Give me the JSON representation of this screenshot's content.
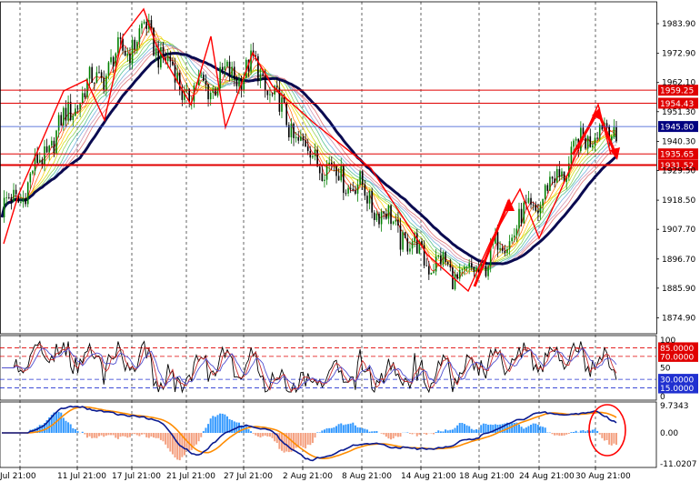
{
  "colors": {
    "background": "#ffffff",
    "border": "#000000",
    "grid": "#000000",
    "bull_candle": "#008000",
    "bear_candle": "#000000",
    "level_line": "#e00000",
    "level_tag": "#e00000",
    "current_line": "#3050d0",
    "current_tag": "#000080",
    "ma_slow": "#0a0a50",
    "annotation": "#ff0000",
    "rsi_main": "#000000",
    "rsi_signal": "#cc3030",
    "rsi_signal2": "#5050d0",
    "osc_level_high": "#e00000",
    "osc_level_low": "#2030d0",
    "osc_tag_high": "#e00000",
    "osc_tag_low": "#2030d0",
    "macd_pos": "#3399ff",
    "macd_neg": "#f4a080",
    "macd_line": "#0a1a90",
    "macd_signal": "#ff8c00"
  },
  "chart_data": [
    {
      "type": "candlestick",
      "title": "",
      "x_tick_labels": [
        "Jul 21:00",
        "11 Jul 21:00",
        "17 Jul 21:00",
        "21 Jul 21:00",
        "27 Jul 21:00",
        "2 Aug 21:00",
        "8 Aug 21:00",
        "14 Aug 21:00",
        "18 Aug 21:00",
        "24 Aug 21:00",
        "30 Aug 21:00"
      ],
      "y_tick_labels": [
        "1983.90",
        "1972.90",
        "1962.10",
        "1951.30",
        "1940.30",
        "1929.50",
        "1918.50",
        "1907.70",
        "1896.70",
        "1885.90",
        "1874.90"
      ],
      "ylim": [
        1869.0,
        1992.0
      ],
      "close_path": {
        "x": [
          "Jul 21:00",
          "11 Jul 21:00",
          "17 Jul 21:00",
          "21 Jul 21:00",
          "27 Jul 21:00",
          "2 Aug 21:00",
          "8 Aug 21:00",
          "14 Aug 21:00",
          "18 Aug 21:00",
          "24 Aug 21:00",
          "30 Aug 21:00"
        ],
        "close": [
          1920.0,
          1956.0,
          1976.0,
          1961.0,
          1957.0,
          1935.0,
          1922.0,
          1898.0,
          1893.0,
          1918.0,
          1941.0
        ]
      },
      "horizontal_levels": [
        {
          "label": "1959.25",
          "value": 1959.25
        },
        {
          "label": "1954.43",
          "value": 1954.43
        },
        {
          "label": "1935.65",
          "value": 1935.65
        },
        {
          "label": "1931.52",
          "value": 1931.52
        }
      ],
      "current_price": {
        "label": "1945.80",
        "value": 1945.8
      },
      "moving_average_ribbon": "present",
      "annotations": "red zig-zag swing lines and arrows"
    },
    {
      "type": "line",
      "title": "",
      "indicator_panel": "oscillator",
      "ylim": [
        0,
        100
      ],
      "y_tick_labels": [
        "100",
        "50",
        "0"
      ],
      "levels": [
        {
          "label": "85.0000",
          "value": 85
        },
        {
          "label": "70.0000",
          "value": 70
        },
        {
          "label": "30.0000",
          "value": 30
        },
        {
          "label": "15.0000",
          "value": 15
        }
      ]
    },
    {
      "type": "bar",
      "title": "",
      "indicator_panel": "macd",
      "y_tick_labels": [
        "9.7343",
        "0.00",
        "-11.0207"
      ],
      "ylim": [
        -11.0207,
        9.7343
      ],
      "annotations": "red ellipse around latest bars"
    }
  ]
}
